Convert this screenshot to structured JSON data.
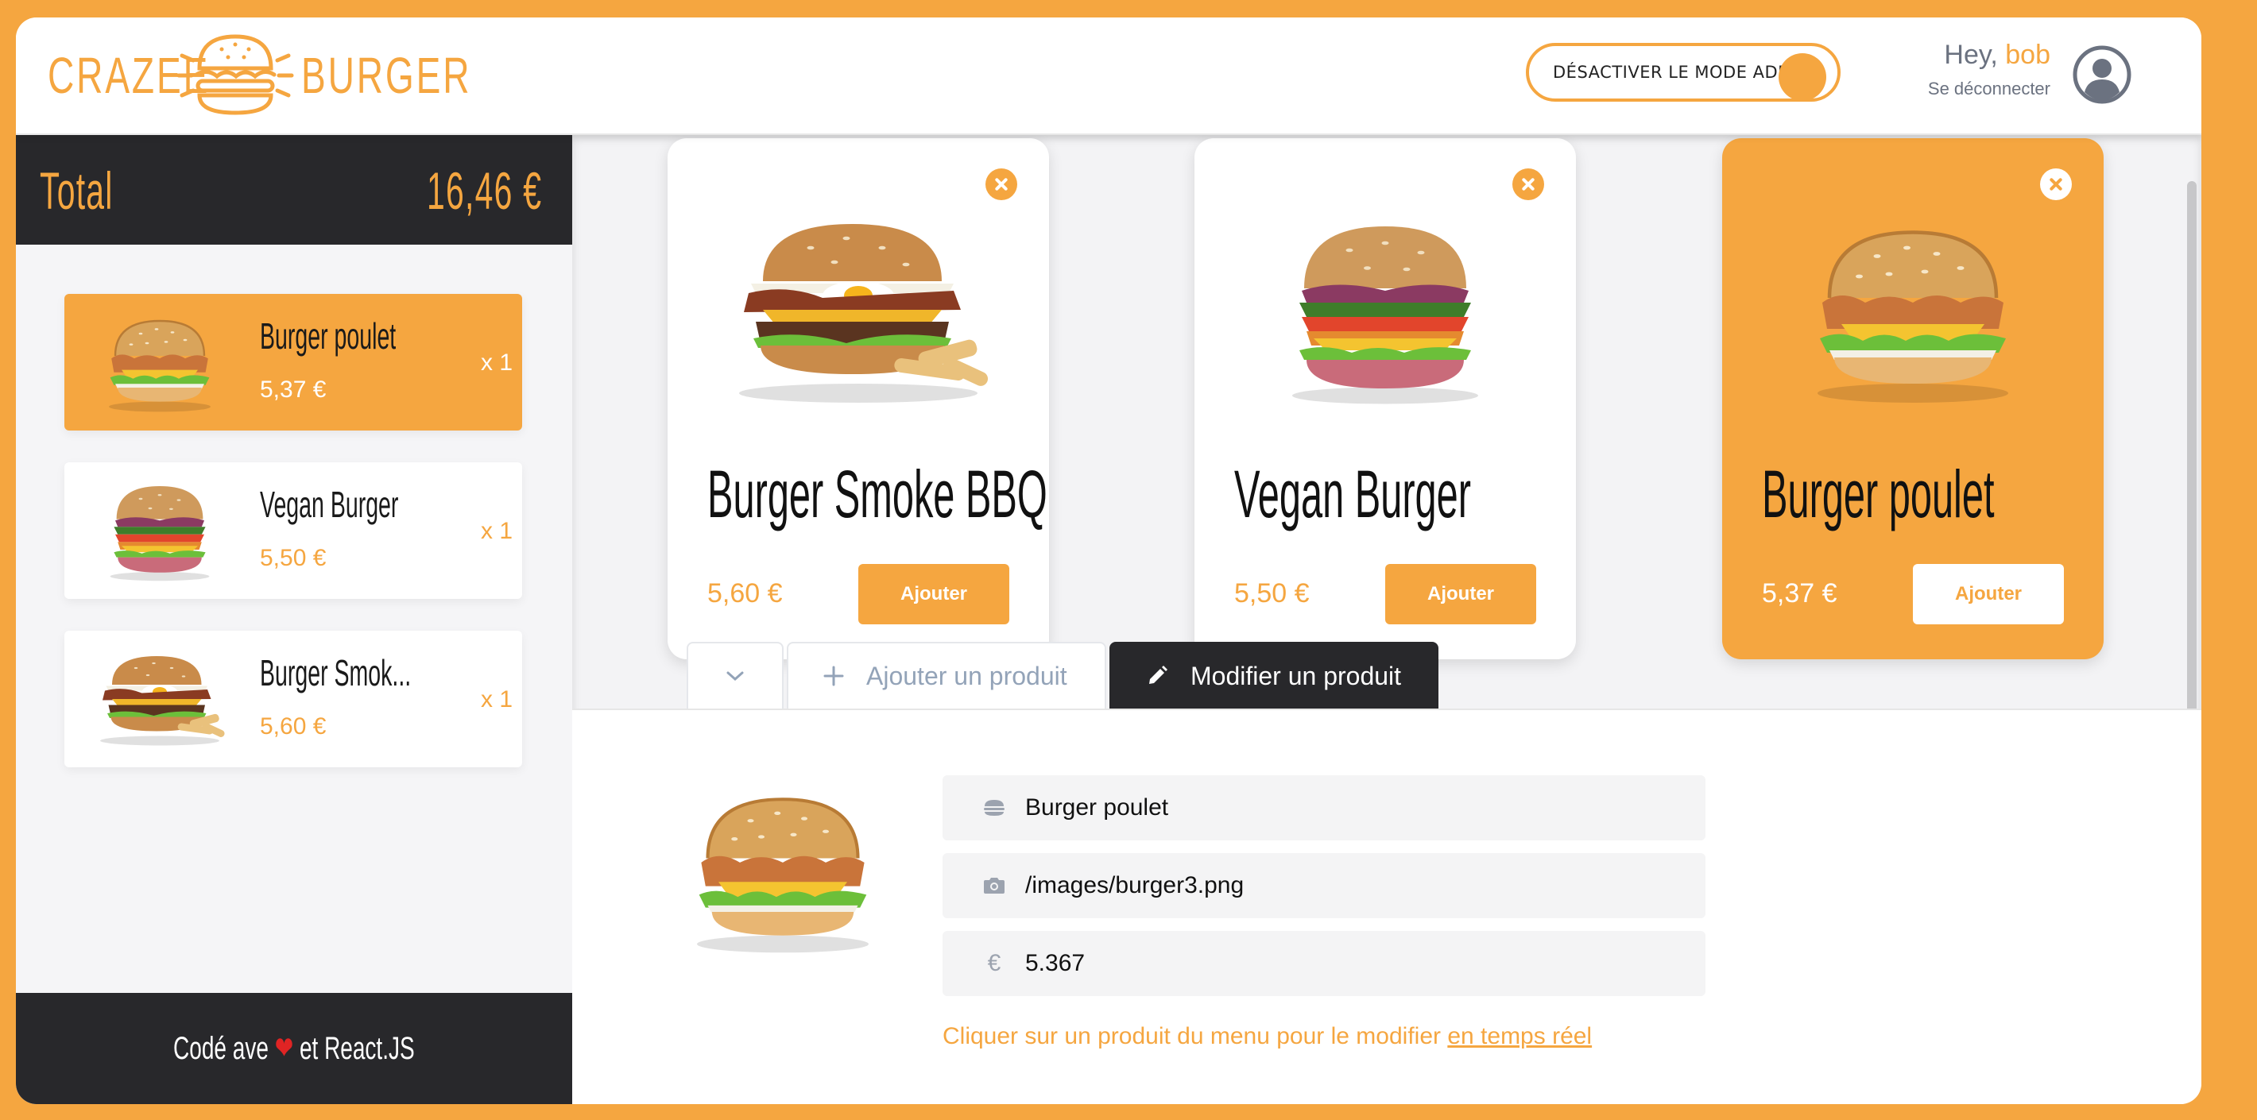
{
  "header": {
    "logo_left": "CRAZEE",
    "logo_right": "BURGER",
    "admin_toggle_label": "DÉSACTIVER LE MODE ADMIN",
    "greeting": "Hey, ",
    "username": "bob",
    "logout_label": "Se déconnecter"
  },
  "basket": {
    "total_label": "Total",
    "total_value": "16,46 €",
    "items": [
      {
        "name": "Burger poulet",
        "price": "5,37 €",
        "qty": "x 1",
        "selected": true
      },
      {
        "name": "Vegan Burger",
        "price": "5,50 €",
        "qty": "x 1",
        "selected": false
      },
      {
        "name": "Burger Smok...",
        "price": "5,60 €",
        "qty": "x 1",
        "selected": false
      }
    ],
    "footer_before": "Codé ave ",
    "footer_after": " et React.JS"
  },
  "menu": {
    "cards": [
      {
        "title": "Burger Smoke BBQ",
        "price": "5,60 €",
        "button": "Ajouter",
        "selected": false
      },
      {
        "title": "Vegan Burger",
        "price": "5,50 €",
        "button": "Ajouter",
        "selected": false
      },
      {
        "title": "Burger poulet",
        "price": "5,37 €",
        "button": "Ajouter",
        "selected": true
      }
    ]
  },
  "admin": {
    "tabs": {
      "add_label": "Ajouter un produit",
      "edit_label": "Modifier un produit"
    },
    "form": {
      "name_value": "Burger poulet",
      "image_value": "/images/burger3.png",
      "price_value": "5.367"
    },
    "hint_text": "Cliquer sur un produit du menu pour le modifier ",
    "hint_link": "en temps réel"
  },
  "colors": {
    "accent": "#f5a640",
    "dark": "#28282b",
    "background": "#f5f5f7"
  },
  "icons": [
    "burger-logo-icon",
    "user-avatar-icon",
    "close-icon",
    "chevron-down-icon",
    "plus-icon",
    "pencil-icon",
    "hamburger-field-icon",
    "camera-icon",
    "euro-icon",
    "heart-icon"
  ]
}
